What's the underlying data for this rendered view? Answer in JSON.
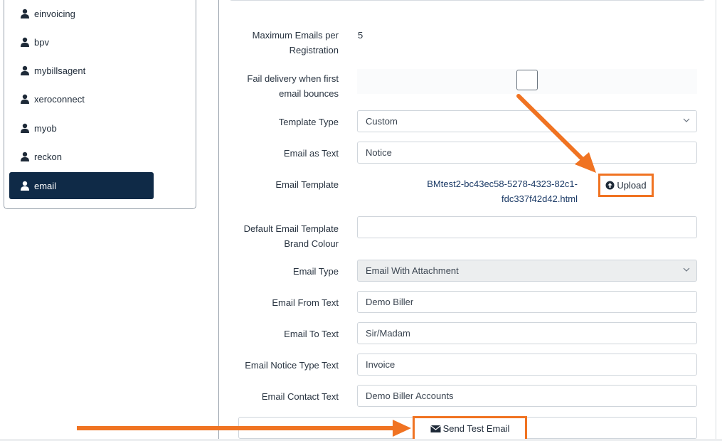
{
  "sidebar": {
    "items": [
      {
        "label": "einvoicing",
        "icon": "user-icon",
        "active": false
      },
      {
        "label": "bpv",
        "icon": "user-icon",
        "active": false
      },
      {
        "label": "mybillsagent",
        "icon": "user-icon",
        "active": false
      },
      {
        "label": "xeroconnect",
        "icon": "user-icon",
        "active": false
      },
      {
        "label": "myob",
        "icon": "user-icon",
        "active": false
      },
      {
        "label": "reckon",
        "icon": "user-icon",
        "active": false
      },
      {
        "label": "email",
        "icon": "user-icon",
        "active": true
      }
    ]
  },
  "form": {
    "max_emails": {
      "label_line1": "Maximum Emails per",
      "label_line2": "Registration",
      "value": "5"
    },
    "fail_delivery": {
      "label_line1": "Fail delivery when first",
      "label_line2": "email bounces",
      "checked": false
    },
    "template_type": {
      "label": "Template Type",
      "value": "Custom"
    },
    "email_as_text": {
      "label": "Email as Text",
      "value": "Notice"
    },
    "email_template": {
      "label": "Email Template",
      "file_line1": "BMtest2-bc43ec58-5278-4323-82c1-",
      "file_line2": "fdc337f42d42.html",
      "upload_label": "Upload"
    },
    "brand_colour": {
      "label_line1": "Default Email Template",
      "label_line2": "Brand Colour",
      "value": ""
    },
    "email_type": {
      "label": "Email Type",
      "value": "Email With Attachment"
    },
    "email_from": {
      "label": "Email From Text",
      "value": "Demo Biller"
    },
    "email_to": {
      "label": "Email To Text",
      "value": "Sir/Madam"
    },
    "notice_type": {
      "label": "Email Notice Type Text",
      "value": "Invoice"
    },
    "contact_text": {
      "label": "Email Contact Text",
      "value": "Demo Biller Accounts"
    },
    "send_test_label": "Send Test Email"
  },
  "colors": {
    "sidebar_active_bg": "#0f2a47",
    "highlight_orange": "#f07322",
    "link_blue": "#1b3a66"
  }
}
